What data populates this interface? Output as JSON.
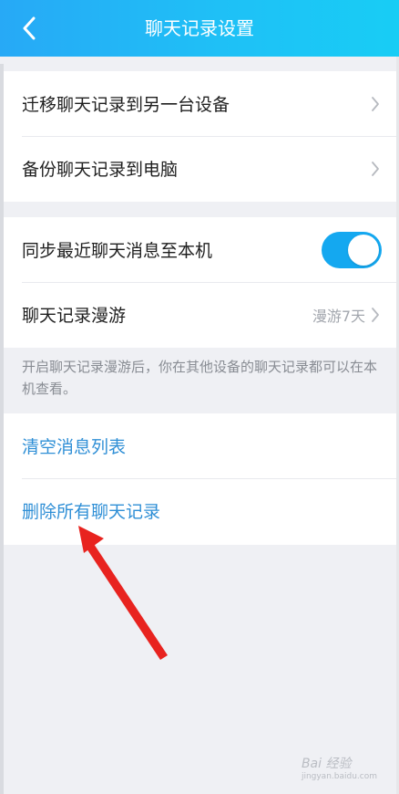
{
  "header": {
    "title": "聊天记录设置",
    "back_icon": "chevron-left-icon"
  },
  "group1": {
    "items": [
      {
        "label": "迁移聊天记录到另一台设备"
      },
      {
        "label": "备份聊天记录到电脑"
      }
    ]
  },
  "group2": {
    "sync_label": "同步最近聊天消息至本机",
    "sync_enabled": true,
    "roam_label": "聊天记录漫游",
    "roam_value": "漫游7天"
  },
  "hint": "开启聊天记录漫游后，你在其他设备的聊天记录都可以在本机查看。",
  "group3": {
    "clear_label": "清空消息列表",
    "delete_label": "删除所有聊天记录"
  },
  "watermark": {
    "text": "Bai 经验",
    "sub": "jingyan.baidu.com"
  },
  "colors": {
    "header_start": "#27a9f6",
    "header_end": "#18cdf5",
    "toggle_on": "#14a8f0",
    "link_blue": "#2f8fd6",
    "annotation_arrow": "#e8231f"
  }
}
